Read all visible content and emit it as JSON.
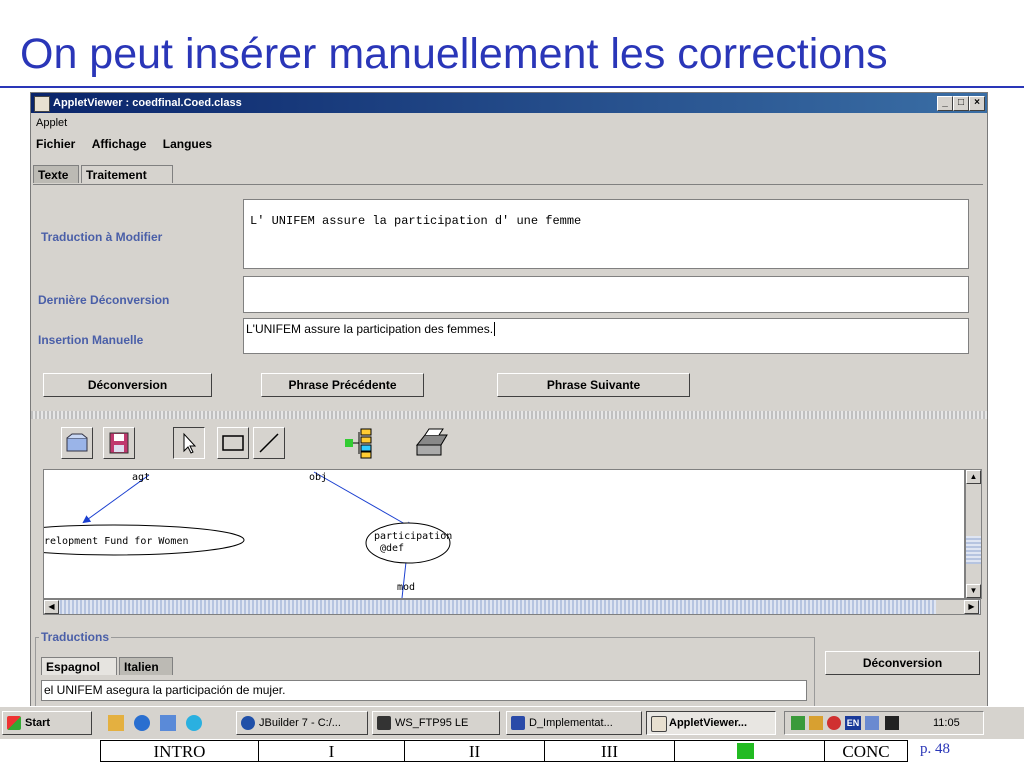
{
  "slide": {
    "title": "On peut insérer manuellement les corrections",
    "page": "p. 48",
    "title_color": "#2a36b8"
  },
  "window": {
    "title": "AppletViewer : coedfinal.Coed.class",
    "controls": [
      "_",
      "□",
      "×"
    ],
    "applet_menu": "Applet",
    "menu": [
      "Fichier",
      "Affichage",
      "Langues"
    ],
    "tabs": [
      "Texte",
      "Traitement"
    ]
  },
  "form": {
    "traduction_label": "Traduction à Modifier",
    "traduction_value": "L' UNIFEM assure la participation d' une femme",
    "deconversion_label": "Dernière Déconversion",
    "deconversion_value": "",
    "insertion_label": "Insertion Manuelle",
    "insertion_value": "L'UNIFEM assure la participation des femmes.",
    "buttons": [
      "Déconversion",
      "Phrase Précédente",
      "Phrase Suivante"
    ]
  },
  "toolbar": {
    "icons": [
      "open-icon",
      "save-icon",
      "pointer-icon",
      "rectangle-icon",
      "line-icon",
      "tree-icon",
      "printer-icon"
    ]
  },
  "graph": {
    "edges": [
      "agt",
      "obj",
      "mod"
    ],
    "nodes": [
      "relopment Fund for Women",
      "participation",
      "@def"
    ]
  },
  "traductions": {
    "legend": "Traductions",
    "tabs": [
      "Espagnol",
      "Italien"
    ],
    "value": "el UNIFEM asegura la participación de mujer.",
    "button": "Déconversion"
  },
  "taskbar": {
    "start": "Start",
    "items": [
      "JBuilder 7 - C:/...",
      "WS_FTP95 LE",
      "D_Implementat...",
      "AppletViewer..."
    ],
    "clock": "11:05",
    "tray_lang": "EN"
  },
  "nav": {
    "cells": [
      "INTRO",
      "I",
      "II",
      "III",
      "",
      "CONC"
    ],
    "active_color": "#22bb22"
  }
}
